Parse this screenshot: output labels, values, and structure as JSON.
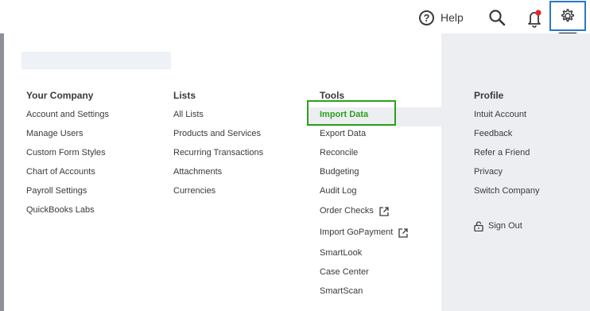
{
  "topbar": {
    "help_label": "Help",
    "help_icon": "question-circle-icon",
    "search_icon": "search-icon",
    "notification_icon": "bell-icon",
    "settings_icon": "gear-icon",
    "notification_dot_color": "#e5262c",
    "settings_outline_color": "#2a77c9"
  },
  "menu": {
    "your_company": {
      "heading": "Your Company",
      "items": [
        "Account and Settings",
        "Manage Users",
        "Custom Form Styles",
        "Chart of Accounts",
        "Payroll Settings",
        "QuickBooks Labs"
      ]
    },
    "lists": {
      "heading": "Lists",
      "items": [
        "All Lists",
        "Products and Services",
        "Recurring Transactions",
        "Attachments",
        "Currencies"
      ]
    },
    "tools": {
      "heading": "Tools",
      "items": [
        "Import Data",
        "Export Data",
        "Reconcile",
        "Budgeting",
        "Audit Log",
        "Order Checks",
        "Import GoPayment",
        "SmartLook",
        "Case Center",
        "SmartScan"
      ],
      "highlight_color": "#2ca01c"
    },
    "profile": {
      "heading": "Profile",
      "items": [
        "Intuit Account",
        "Feedback",
        "Refer a Friend",
        "Privacy",
        "Switch Company"
      ],
      "sign_out": "Sign Out"
    }
  }
}
